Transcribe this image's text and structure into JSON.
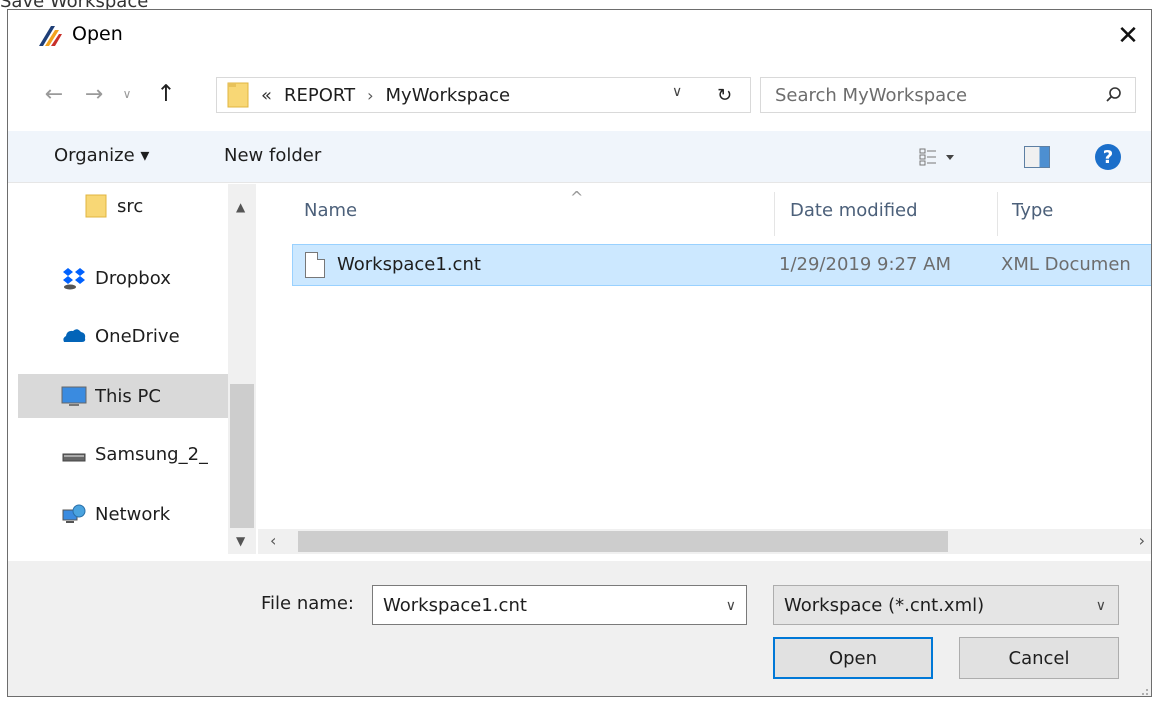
{
  "caption": "Save Workspace",
  "dialog": {
    "title": "Open",
    "close_glyph": "✕"
  },
  "nav": {
    "back_glyph": "←",
    "forward_glyph": "→",
    "recent_glyph": "∨",
    "up_glyph": "↑",
    "address": {
      "overflow_glyph": "«",
      "crumbs": [
        "REPORT",
        "MyWorkspace"
      ],
      "separator": "›",
      "dropdown_glyph": "∨",
      "refresh_glyph": "↻"
    },
    "search_placeholder": "Search MyWorkspace"
  },
  "commands": {
    "organize_label": "Organize ▾",
    "new_folder_label": "New folder",
    "help_label": "?"
  },
  "sidebar": {
    "items": [
      {
        "label": "src",
        "icon": "folder-icon"
      },
      {
        "label": "Dropbox",
        "icon": "dropbox-icon"
      },
      {
        "label": "OneDrive",
        "icon": "onedrive-icon"
      },
      {
        "label": "This PC",
        "icon": "monitor-icon",
        "selected": true
      },
      {
        "label": "Samsung_2_",
        "icon": "drive-icon"
      },
      {
        "label": "Network",
        "icon": "network-icon"
      }
    ]
  },
  "filelist": {
    "columns": [
      "Name",
      "Date modified",
      "Type"
    ],
    "sort_glyph": "^",
    "rows": [
      {
        "name": "Workspace1.cnt",
        "date": "1/29/2019 9:27 AM",
        "type": "XML Documen"
      }
    ]
  },
  "footer": {
    "file_name_label": "File name:",
    "file_name_value": "Workspace1.cnt",
    "file_type_value": "Workspace (*.cnt.xml)",
    "open_label": "Open",
    "cancel_label": "Cancel"
  },
  "colors": {
    "accent": "#0078d7",
    "selection": "#cce8ff",
    "command_bar": "#f0f5fb",
    "footer": "#f0f0f0"
  }
}
